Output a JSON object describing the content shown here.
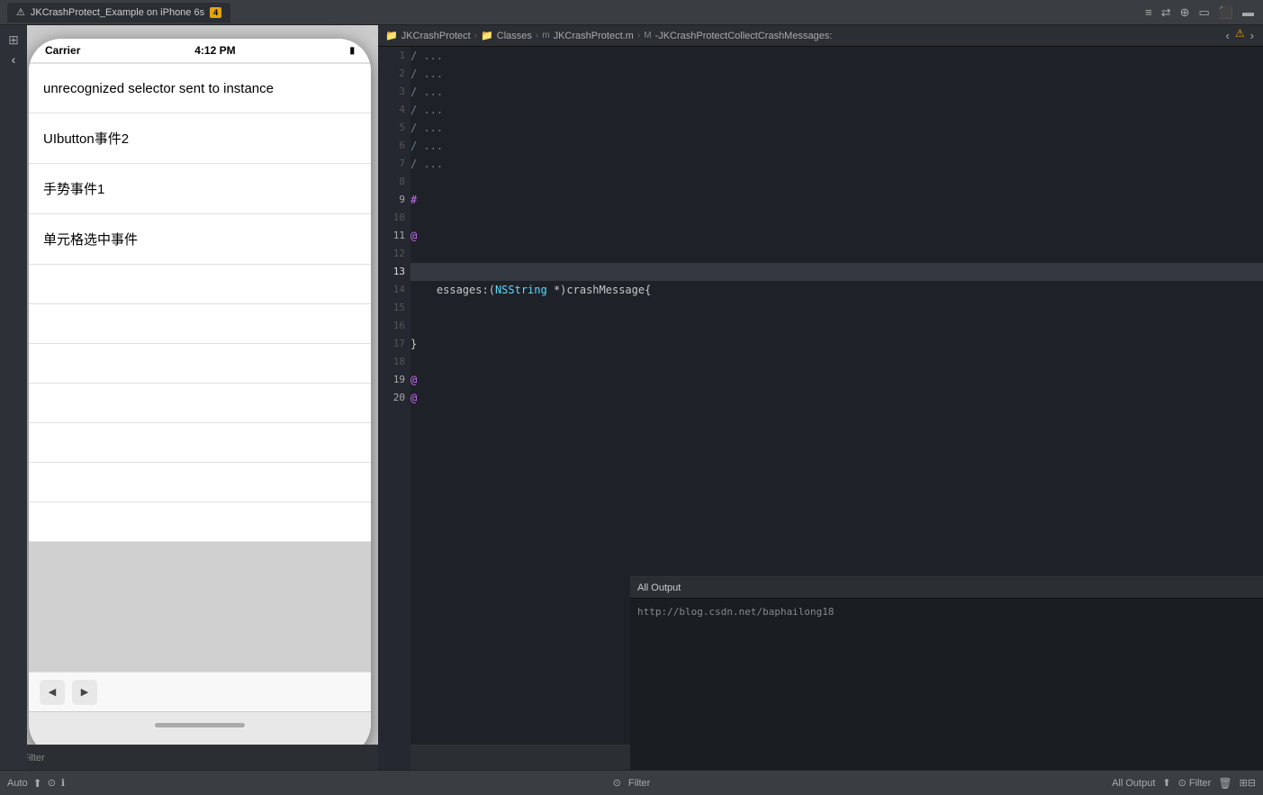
{
  "topbar": {
    "tab_label": "JKCrashProtect_Example on iPhone 6s",
    "warning_count": "4",
    "icons": [
      "⊞",
      "↩",
      "↪",
      "⬜",
      "▭",
      "▬"
    ]
  },
  "breadcrumb": {
    "items": [
      {
        "type": "folder",
        "label": "JKCrashProtect"
      },
      {
        "type": "folder",
        "label": "Classes"
      },
      {
        "type": "file",
        "label": "JKCrashProtect.m"
      },
      {
        "type": "method",
        "label": "-JKCrashProtectCollectCrashMessages:"
      }
    ],
    "nav_left": "‹",
    "nav_right": "›",
    "warning_icon": "⚠"
  },
  "simulator": {
    "status_carrier": "Carrier",
    "status_time": "4:12 PM",
    "list_items": [
      "unrecognized selector sent to instance",
      "UIbutton事件2",
      "手势事件1",
      "单元格选中事件"
    ],
    "bottom_icons": [
      "◀",
      "▶"
    ]
  },
  "editor": {
    "lines": [
      {
        "num": "1",
        "content": "/",
        "type": "comment",
        "marker": false
      },
      {
        "num": "2",
        "content": "/",
        "type": "comment",
        "marker": false
      },
      {
        "num": "3",
        "content": "/",
        "type": "comment",
        "marker": false
      },
      {
        "num": "4",
        "content": "/",
        "type": "comment",
        "marker": false
      },
      {
        "num": "5",
        "content": "/",
        "type": "comment",
        "marker": false
      },
      {
        "num": "6",
        "content": "/",
        "type": "comment",
        "marker": false
      },
      {
        "num": "7",
        "content": "/",
        "type": "comment",
        "marker": false
      },
      {
        "num": "8",
        "content": "",
        "type": "normal",
        "marker": false
      },
      {
        "num": "9",
        "content": "#",
        "type": "preprocessor",
        "marker": false
      },
      {
        "num": "10",
        "content": "",
        "type": "normal",
        "marker": false
      },
      {
        "num": "11",
        "content": "@",
        "type": "keyword",
        "marker": true
      },
      {
        "num": "12",
        "content": "",
        "type": "normal",
        "marker": false
      },
      {
        "num": "13",
        "content": "–",
        "type": "method",
        "marker": true
      },
      {
        "num": "14",
        "content": "",
        "type": "normal",
        "marker": false
      },
      {
        "num": "15",
        "content": "",
        "type": "normal",
        "marker": false
      },
      {
        "num": "16",
        "content": "",
        "type": "normal",
        "marker": false
      },
      {
        "num": "17",
        "content": "}",
        "type": "brace",
        "marker": false
      },
      {
        "num": "18",
        "content": "",
        "type": "normal",
        "marker": false
      },
      {
        "num": "19",
        "content": "@",
        "type": "keyword",
        "marker": true
      },
      {
        "num": "20",
        "content": "@",
        "type": "keyword",
        "marker": true
      }
    ],
    "code_snippet": "essages:(NSString *)crashMessage{",
    "nsstring_keyword": "NSString",
    "highlighted_line": 13
  },
  "debug_panel": {
    "tab_label": "All Output",
    "url": "http://blog.csdn.net/baphailong18",
    "filter_label": "Filter",
    "clear_icon": "🗑",
    "icons_right": [
      "⊞",
      "⊟"
    ]
  },
  "status_bar": {
    "left": {
      "auto_label": "Auto",
      "icons": [
        "⬆",
        "⊙",
        "ℹ"
      ]
    },
    "right": {
      "filter_label": "Filter",
      "all_output_label": "All Output"
    }
  }
}
